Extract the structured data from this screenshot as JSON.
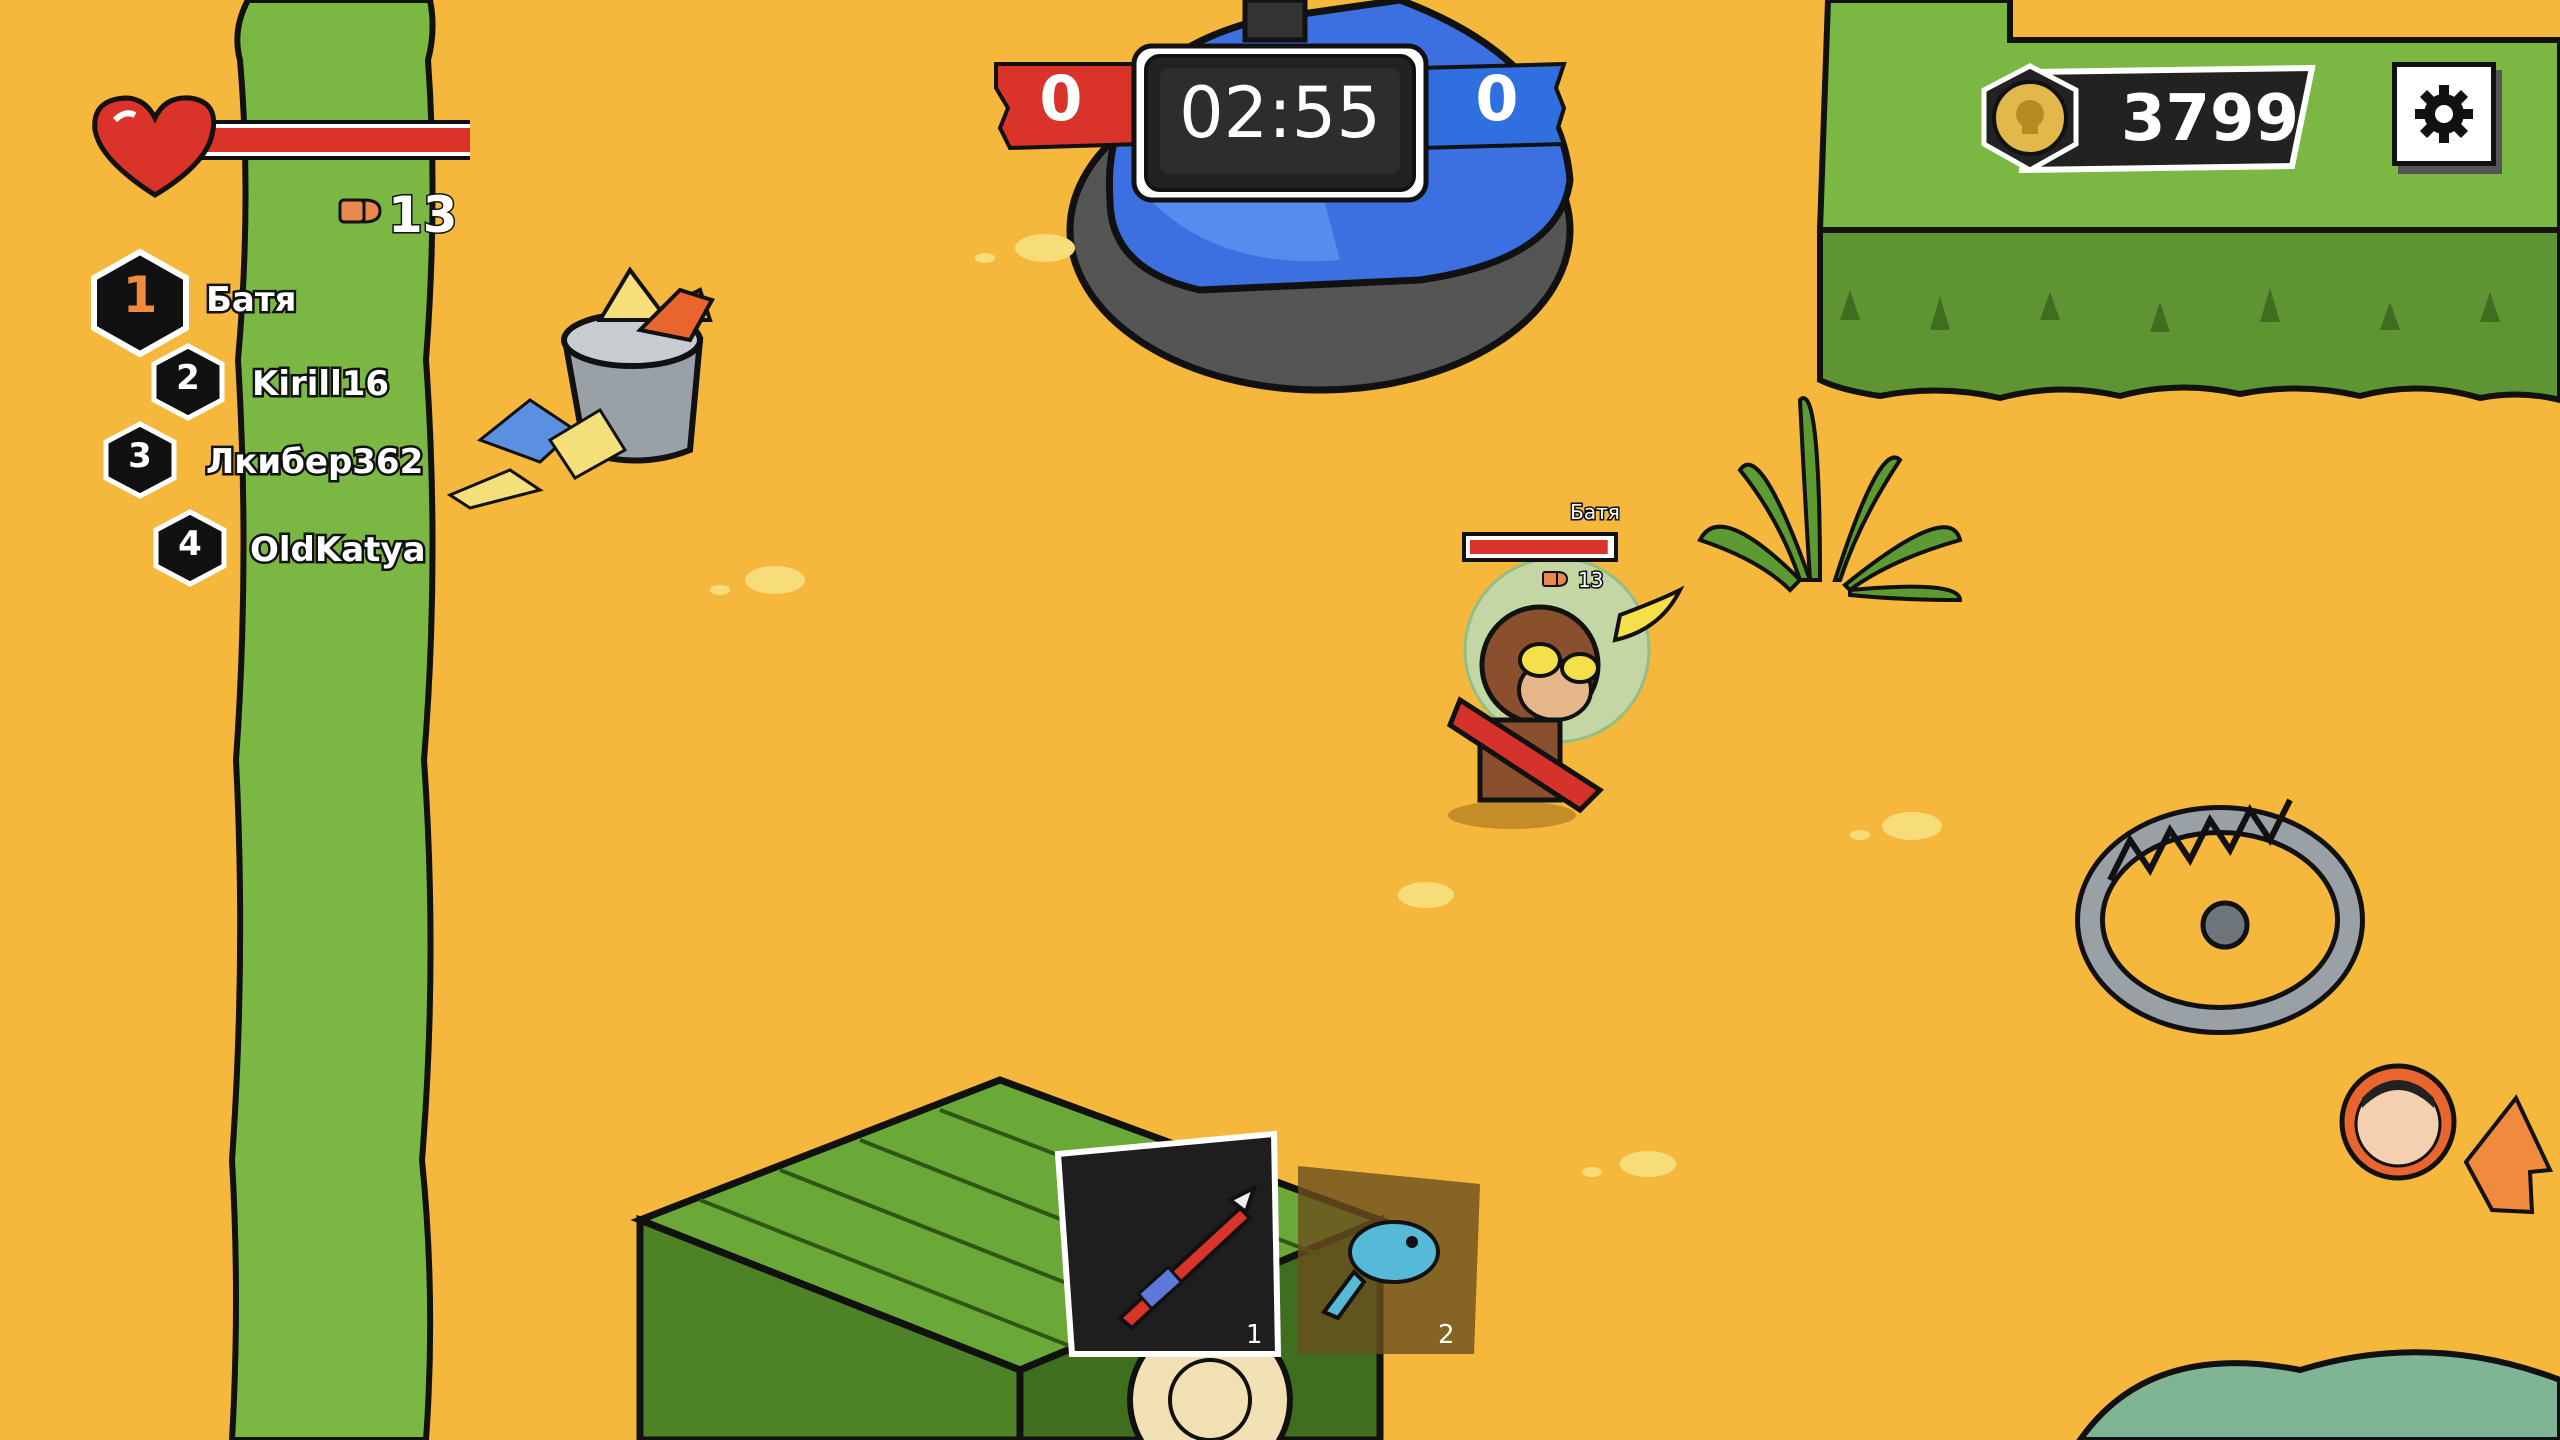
{
  "hud": {
    "health_fraction": 0.95,
    "ammo": "13"
  },
  "leaderboard": [
    {
      "rank": "1",
      "name": "Батя"
    },
    {
      "rank": "2",
      "name": "Kirill16"
    },
    {
      "rank": "3",
      "name": "Лкибер362"
    },
    {
      "rank": "4",
      "name": "OldKatya"
    }
  ],
  "match": {
    "red_score": "0",
    "blue_score": "0",
    "timer": "02:55"
  },
  "wallet": {
    "coins": "3799",
    "icon": "skull-coin-icon"
  },
  "settings": {
    "icon": "gear-icon"
  },
  "player": {
    "name": "Батя",
    "ammo": "13",
    "health_fraction": 0.95
  },
  "weapons": [
    {
      "slot": "1",
      "icon": "rocket-launcher-icon",
      "selected": true
    },
    {
      "slot": "2",
      "icon": "blowfish-gun-icon",
      "selected": false
    }
  ],
  "offscreen_enemy": {
    "icon": "enemy-avatar-icon",
    "direction": "right"
  },
  "colors": {
    "ground": "#f5b73c",
    "hedge": "#7bb843",
    "team_red": "#d9332a",
    "team_blue": "#2f6fe0",
    "outline": "#111111"
  }
}
